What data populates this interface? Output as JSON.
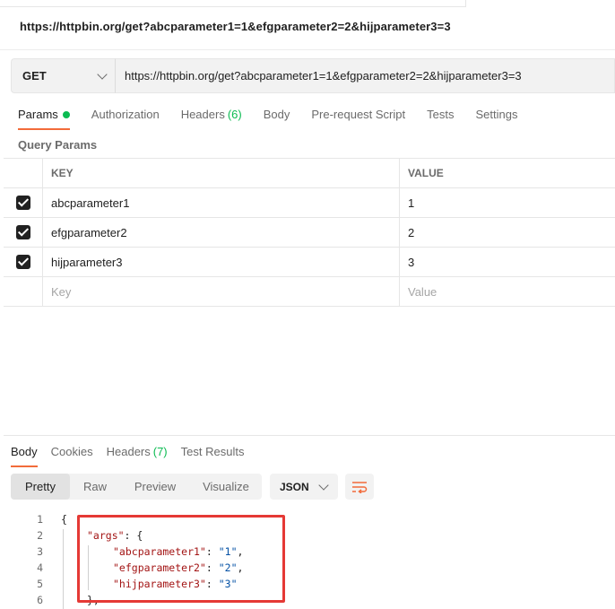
{
  "request": {
    "title": "https://httpbin.org/get?abcparameter1=1&efgparameter2=2&hijparameter3=3",
    "method": "GET",
    "url": "https://httpbin.org/get?abcparameter1=1&efgparameter2=2&hijparameter3=3"
  },
  "request_tabs": [
    {
      "label": "Params",
      "active": true
    },
    {
      "label": "Authorization"
    },
    {
      "label": "Headers",
      "count": "(6)"
    },
    {
      "label": "Body"
    },
    {
      "label": "Pre-request Script"
    },
    {
      "label": "Tests"
    },
    {
      "label": "Settings"
    }
  ],
  "query_params": {
    "section_label": "Query Params",
    "headers": {
      "key": "KEY",
      "value": "VALUE"
    },
    "rows": [
      {
        "key": "abcparameter1",
        "value": "1",
        "checked": true
      },
      {
        "key": "efgparameter2",
        "value": "2",
        "checked": true
      },
      {
        "key": "hijparameter3",
        "value": "3",
        "checked": true
      }
    ],
    "placeholder": {
      "key": "Key",
      "value": "Value"
    }
  },
  "response_tabs": [
    {
      "label": "Body",
      "active": true
    },
    {
      "label": "Cookies"
    },
    {
      "label": "Headers",
      "count": "(7)"
    },
    {
      "label": "Test Results"
    }
  ],
  "view_modes": [
    "Pretty",
    "Raw",
    "Preview",
    "Visualize"
  ],
  "active_view": "Pretty",
  "format": "JSON",
  "code_lines": [
    {
      "n": "1",
      "text": "{"
    },
    {
      "n": "2",
      "key": "\"args\"",
      "rest": ": {"
    },
    {
      "n": "3",
      "key": "\"abcparameter1\"",
      "sep": ": ",
      "val": "\"1\"",
      "end": ","
    },
    {
      "n": "4",
      "key": "\"efgparameter2\"",
      "sep": ": ",
      "val": "\"2\"",
      "end": ","
    },
    {
      "n": "5",
      "key": "\"hijparameter3\"",
      "sep": ": ",
      "val": "\"3\"",
      "end": ""
    },
    {
      "n": "6",
      "text": "},"
    }
  ],
  "colors": {
    "accent_tab": "#f26b3a",
    "status_dot": "#0cbb52",
    "highlight_box": "#e53935",
    "wrap_icon": "#f26b3a"
  }
}
